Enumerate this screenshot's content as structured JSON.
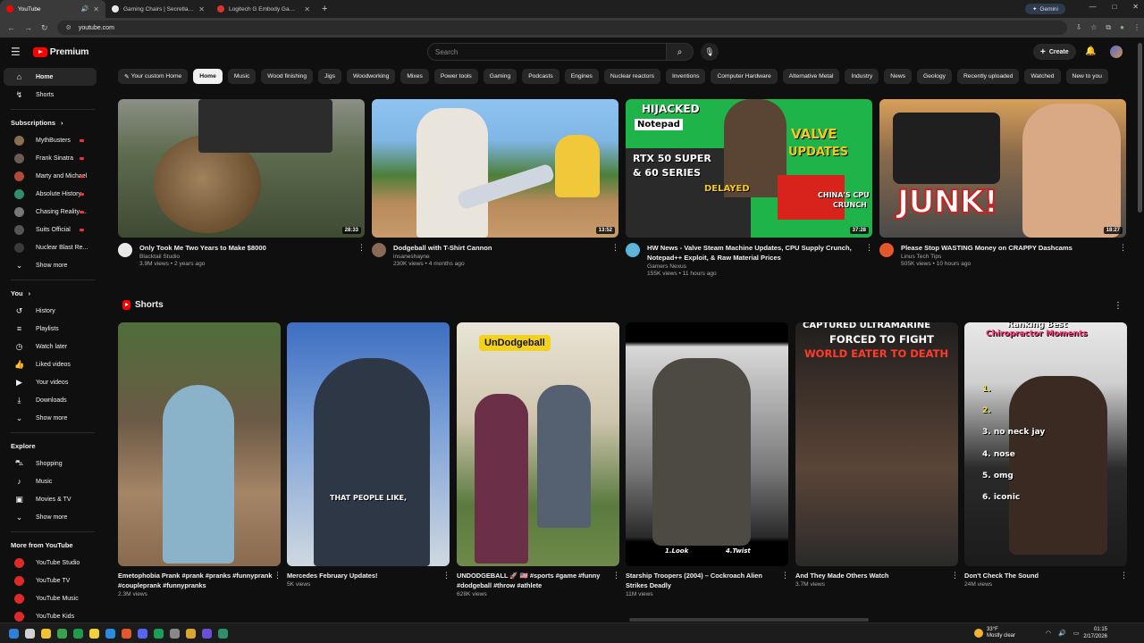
{
  "browser": {
    "tabs": [
      {
        "label": "YouTube",
        "active": true
      },
      {
        "label": "Gaming Chairs | Secretlab TITAN"
      },
      {
        "label": "Logitech G Embody Gaming Ch"
      }
    ],
    "gemini_label": "Gemini",
    "url": "youtube.com"
  },
  "header": {
    "logo_text": "Premium",
    "search_placeholder": "Search",
    "create_label": "Create"
  },
  "sidebar": {
    "main": [
      {
        "label": "Home",
        "icon": "home-icon"
      },
      {
        "label": "Shorts",
        "icon": "shorts-icon"
      }
    ],
    "subscriptions_label": "Subscriptions",
    "subscriptions": [
      {
        "label": "MythBusters",
        "color": "#8a6f4f"
      },
      {
        "label": "Frank Sinatra",
        "color": "#6b5d55"
      },
      {
        "label": "Marty and Michael",
        "color": "#b04a3a"
      },
      {
        "label": "Absolute History",
        "color": "#2f8f6a"
      },
      {
        "label": "Chasing Reality ...",
        "color": "#777"
      },
      {
        "label": "Suits Official",
        "color": "#555"
      },
      {
        "label": "Nuclear Blast Re...",
        "color": "#3a3a3a"
      }
    ],
    "show_more": "Show more",
    "you_label": "You",
    "you": [
      {
        "label": "History"
      },
      {
        "label": "Playlists"
      },
      {
        "label": "Watch later"
      },
      {
        "label": "Liked videos"
      },
      {
        "label": "Your videos"
      },
      {
        "label": "Downloads"
      },
      {
        "label": "Show more"
      }
    ],
    "explore_label": "Explore",
    "explore": [
      {
        "label": "Shopping"
      },
      {
        "label": "Music"
      },
      {
        "label": "Movies & TV"
      },
      {
        "label": "Show more"
      }
    ],
    "more_label": "More from YouTube",
    "more": [
      {
        "label": "YouTube Studio"
      },
      {
        "label": "YouTube TV"
      },
      {
        "label": "YouTube Music"
      },
      {
        "label": "YouTube Kids"
      }
    ]
  },
  "chips": [
    "Your custom Home",
    "Home",
    "Music",
    "Wood finishing",
    "Jigs",
    "Woodworking",
    "Mixes",
    "Power tools",
    "Gaming",
    "Podcasts",
    "Engines",
    "Nuclear reactors",
    "Inventions",
    "Computer Hardware",
    "Alternative Metal",
    "Industry",
    "News",
    "Geology",
    "Recently uploaded",
    "Watched",
    "New to you"
  ],
  "videos": [
    {
      "title": "Only Took Me Two Years to Make $8000",
      "channel": "Blacktail Studio",
      "stats": "3.9M views • 2 years ago",
      "duration": "28:33"
    },
    {
      "title": "Dodgeball with T-Shirt Cannon",
      "channel": "insaneshayne",
      "stats": "230K views • 4 months ago",
      "duration": "13:52"
    },
    {
      "title": "HW News - Valve Steam Machine Updates, CPU Supply Crunch, Notepad++ Exploit, & Raw Material Prices",
      "channel": "Gamers Nexus",
      "stats": "155K views • 11 hours ago",
      "duration": "37:28"
    },
    {
      "title": "Please Stop WASTING Money on CRAPPY Dashcams",
      "channel": "Linus Tech Tips",
      "stats": "505K views • 10 hours ago",
      "duration": "18:27"
    }
  ],
  "thumb_text": {
    "v3_hijacked": "HIJACKED",
    "v3_notepad": "Notepad",
    "v3_valve": "VALVE",
    "v3_updates": "UPDATES",
    "v3_rtx": "RTX 50 SUPER",
    "v3_series": "& 60 SERIES",
    "v3_delayed": "DELAYED",
    "v3_china": "CHINA'S CPU",
    "v3_crunch": "CRUNCH",
    "v4_junk": "JUNK!",
    "s3_banner": "UnDodgeball",
    "s2_caption": "THAT PEOPLE LIKE,",
    "s4_cap1": "1.Look",
    "s4_cap2": "4.Twist",
    "s5_l1": "CAPTURED ULTRAMARINE",
    "s5_l2": "FORCED TO FIGHT",
    "s5_l3": "WORLD EATER TO DEATH",
    "s6_title1": "Ranking Best",
    "s6_title2": "Chiropractor Moments",
    "s6_items": [
      "1.",
      "2.",
      "3. no neck jay",
      "4. nose",
      "5. omg",
      "6. iconic"
    ]
  },
  "shorts_label": "Shorts",
  "shorts": [
    {
      "title": "Emetophobia Prank #prank #pranks #funnyprank #coupleprank #funnypranks",
      "stats": "2.3M views"
    },
    {
      "title": "Mercedes February Updates!",
      "stats": "5K views"
    },
    {
      "title": "UNDODGEBALL 🚀 🇺🇸 #sports #game #funny #dodgeball #throw #athlete",
      "stats": "628K views"
    },
    {
      "title": "Starship Troopers (2004) – Cockroach Alien Strikes Deadly",
      "stats": "11M views"
    },
    {
      "title": "And They Made Others Watch",
      "stats": "3.7M views"
    },
    {
      "title": "Don't Check The Sound",
      "stats": "24M views"
    }
  ],
  "taskbar": {
    "temp": "33°F",
    "weather": "Mostly clear",
    "time": "01:15",
    "date": "2/17/2026"
  }
}
